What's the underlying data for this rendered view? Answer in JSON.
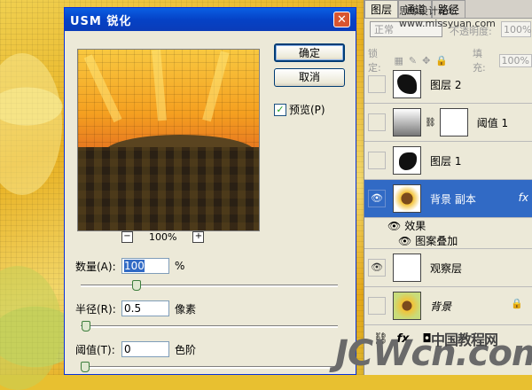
{
  "dialog": {
    "title": "USM 锐化",
    "close_glyph": "✕",
    "ok_label": "确定",
    "cancel_label": "取消",
    "preview_label": "预览(P)",
    "preview_checked": true,
    "zoom_level": "100%",
    "zoom_out": "−",
    "zoom_in": "+",
    "fields": [
      {
        "label": "数量(A):",
        "value": "100",
        "unit": "%",
        "slider_value": 100,
        "slider_max": 500
      },
      {
        "label": "半径(R):",
        "value": "0.5",
        "unit": "像素",
        "slider_value": 0.5,
        "slider_max": 250
      },
      {
        "label": "阈值(T):",
        "value": "0",
        "unit": "色阶",
        "slider_value": 0,
        "slider_max": 255
      }
    ]
  },
  "layers_panel": {
    "tabs": [
      "图层",
      "通道",
      "路径"
    ],
    "watermark": "思缘设计论坛 www.missyuan.com",
    "blend_mode": "正常",
    "opacity_label": "不透明度:",
    "opacity_value": "100%",
    "lock_label": "锁定:",
    "fill_label": "填充:",
    "fill_value": "100%",
    "layers": [
      {
        "name": "图层 2",
        "visible": false,
        "selected": false
      },
      {
        "name": "阈值 1",
        "visible": false,
        "selected": false
      },
      {
        "name": "图层 1",
        "visible": false,
        "selected": false
      },
      {
        "name": "背景 副本",
        "visible": true,
        "selected": true,
        "fx": "fx"
      },
      {
        "name": "观察层",
        "visible": true,
        "selected": false
      },
      {
        "name": "背景",
        "visible": false,
        "selected": false,
        "locked": true
      }
    ],
    "effects_label": "效果",
    "effect_item": "图案叠加",
    "bottom_icons": [
      "link-icon",
      "fx-icon",
      "mask-icon"
    ]
  },
  "site_logo": "JCWcn.com",
  "site_logo_cn": "中国教程网",
  "colors": {
    "accent": "#316ac5",
    "titlebar": "#0542c6",
    "close": "#d8552f"
  }
}
